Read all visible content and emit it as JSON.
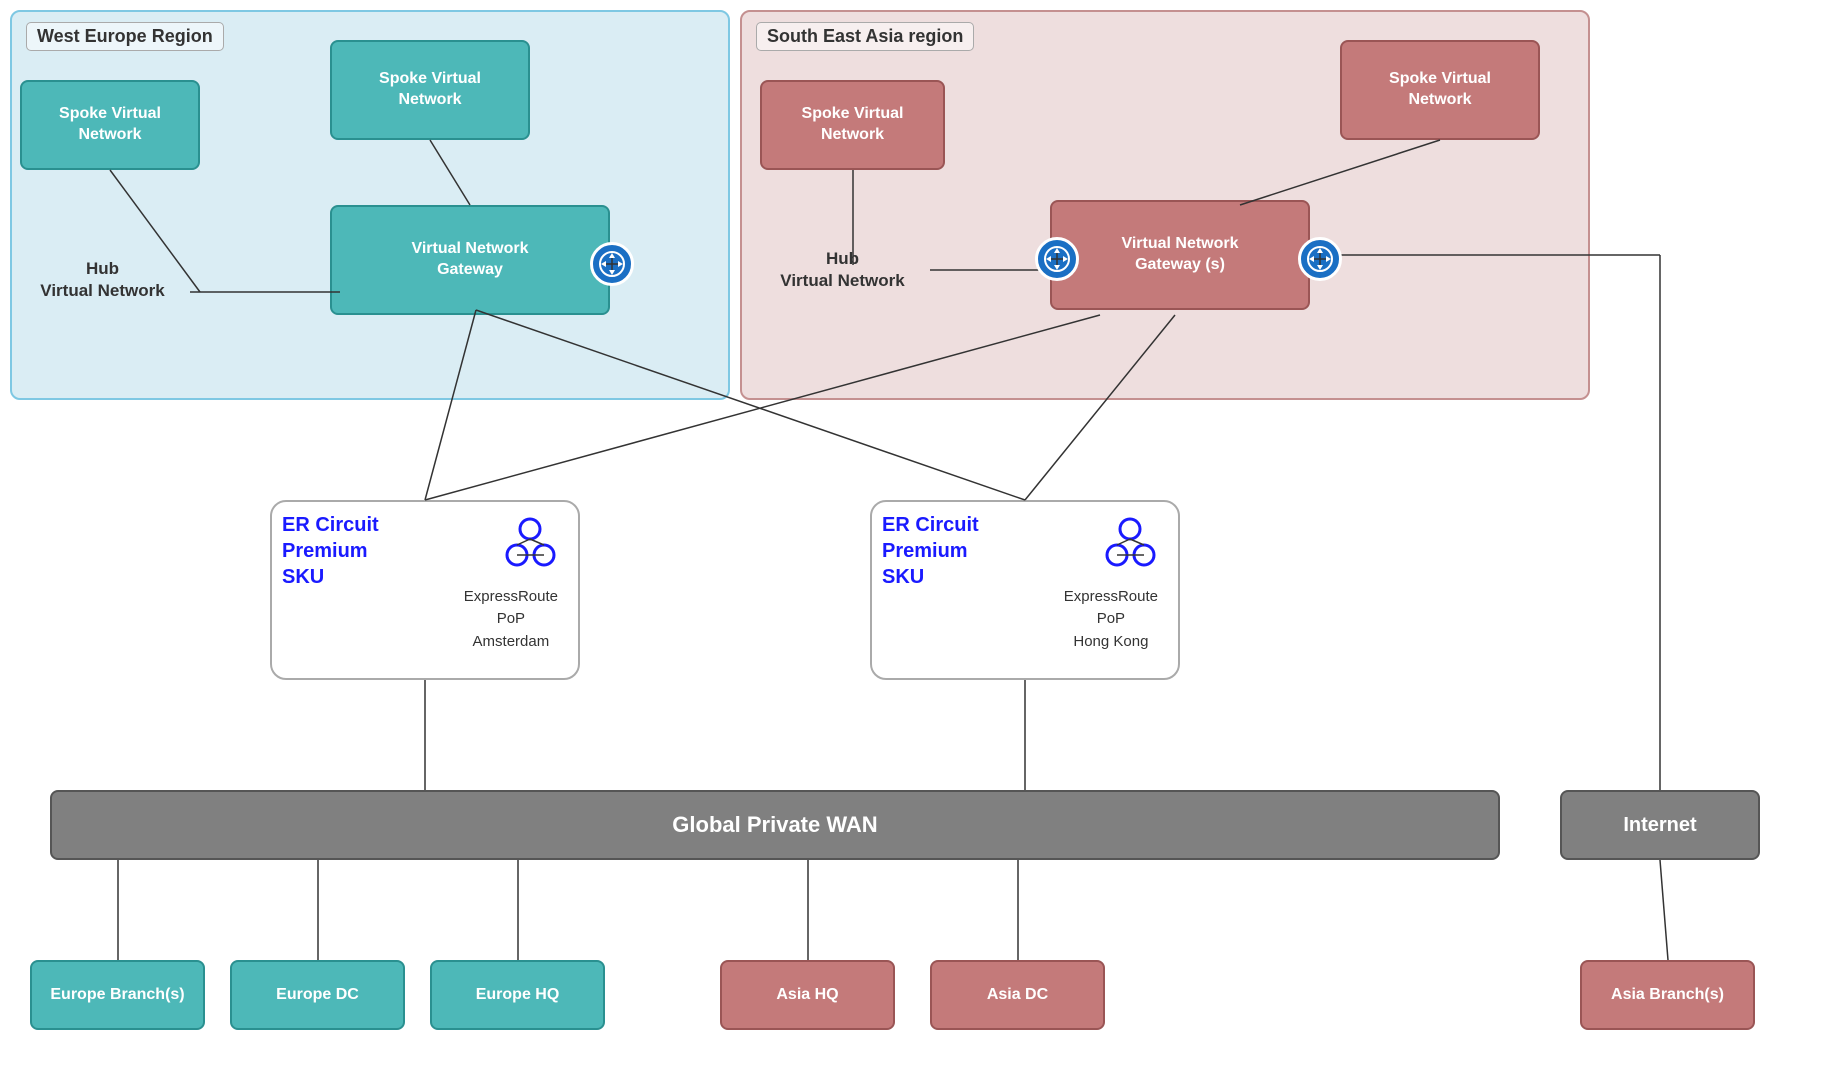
{
  "regions": {
    "west": {
      "label": "West Europe Region"
    },
    "sea": {
      "label": "South East Asia region"
    }
  },
  "west_europe": {
    "spoke_vn1": "Spoke Virtual\nNetwork",
    "spoke_vn2": "Spoke Virtual\nNetwork",
    "hub_vn": "Hub\nVirtual Network",
    "vng": "Virtual Network\nGateway"
  },
  "south_east_asia": {
    "spoke_vn1": "Spoke Virtual\nNetwork",
    "spoke_vn2": "Spoke Virtual\nNetwork",
    "hub_vn": "Hub\nVirtual Network",
    "vng": "Virtual Network\nGateway (s)"
  },
  "er_circuits": {
    "left": {
      "label": "ER Circuit\nPremium\nSKU",
      "pop": "ExpressRoute\nPoP\nAmsterdam"
    },
    "right": {
      "label": "ER Circuit\nPremium\nSKU",
      "pop": "ExpressRoute\nPoP\nHong Kong"
    }
  },
  "wan": {
    "label": "Global Private WAN"
  },
  "internet": {
    "label": "Internet"
  },
  "bottom_nodes": {
    "europe_branch": "Europe Branch(s)",
    "europe_dc": "Europe DC",
    "europe_hq": "Europe HQ",
    "asia_hq": "Asia HQ",
    "asia_dc": "Asia DC",
    "asia_branch": "Asia Branch(s)"
  }
}
